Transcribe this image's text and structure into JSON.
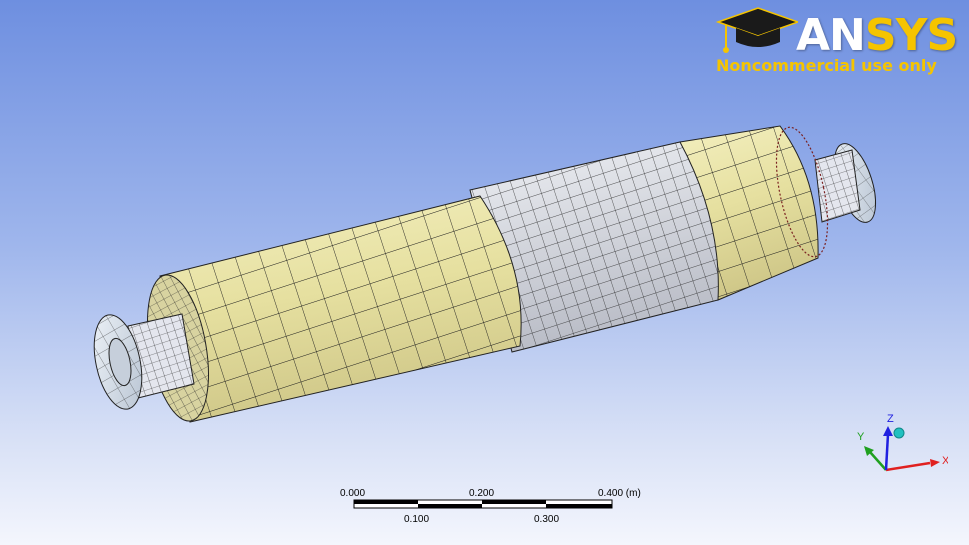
{
  "logo": {
    "brand_main": "AN",
    "brand_accent": "SYS",
    "tagline": "Noncommercial use only",
    "colors": {
      "accent": "#f5c400",
      "brand": "#ffffff"
    }
  },
  "model": {
    "description_icon": "meshed-shaft-model",
    "colors": {
      "shell": "#e8e3a6",
      "core_section": "#d4d7df",
      "flange": "#d9e3ee",
      "mesh_line": "#1a1a1a"
    }
  },
  "scale_bar": {
    "top_labels": [
      "0.000",
      "0.200",
      "0.400 (m)"
    ],
    "bottom_labels": [
      "0.100",
      "0.300"
    ]
  },
  "triad": {
    "axes": {
      "x": "X",
      "y": "Y",
      "z": "Z"
    },
    "colors": {
      "x": "#e02020",
      "y": "#20a020",
      "z": "#2020e0",
      "ball": "#20c0c0"
    }
  }
}
